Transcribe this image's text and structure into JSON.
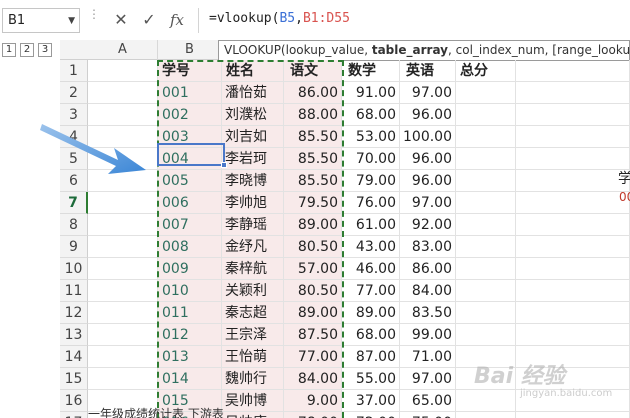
{
  "name_box": {
    "value": "B1"
  },
  "formula_bar": {
    "prefix": "=vlookup(",
    "ref1": "B5",
    "sep": ",",
    "ref2": "B1:D55",
    "fx_label": "fx"
  },
  "tooltip": {
    "func": "VLOOKUP(",
    "arg1": "lookup_value, ",
    "arg2": "table_array",
    "rest": ", col_index_num, [range_lookup])"
  },
  "outline_levels": [
    "1",
    "2",
    "3"
  ],
  "columns": {
    "a": "A",
    "b": "B"
  },
  "rows": [
    {
      "num": "1",
      "b": "学号",
      "c": "姓名",
      "d": "语文",
      "e": "数学",
      "f": "英语",
      "g": "总分",
      "header": true
    },
    {
      "num": "2",
      "b": "001",
      "c": "潘怡茹",
      "d": "86.00",
      "e": "91.00",
      "f": "97.00"
    },
    {
      "num": "3",
      "b": "002",
      "c": "刘濮松",
      "d": "88.00",
      "e": "68.00",
      "f": "96.00"
    },
    {
      "num": "4",
      "b": "003",
      "c": "刘吉如",
      "d": "85.50",
      "e": "53.00",
      "f": "100.00"
    },
    {
      "num": "5",
      "b": "004",
      "c": "李岩珂",
      "d": "85.50",
      "e": "70.00",
      "f": "96.00"
    },
    {
      "num": "6",
      "b": "005",
      "c": "李晓博",
      "d": "85.50",
      "e": "79.00",
      "f": "96.00"
    },
    {
      "num": "7",
      "b": "006",
      "c": "李帅旭",
      "d": "79.50",
      "e": "76.00",
      "f": "97.00",
      "selected": true
    },
    {
      "num": "8",
      "b": "007",
      "c": "李静瑶",
      "d": "89.00",
      "e": "61.00",
      "f": "92.00"
    },
    {
      "num": "9",
      "b": "008",
      "c": "金纾凡",
      "d": "80.50",
      "e": "43.00",
      "f": "83.00"
    },
    {
      "num": "10",
      "b": "009",
      "c": "秦梓航",
      "d": "57.00",
      "e": "46.00",
      "f": "86.00"
    },
    {
      "num": "11",
      "b": "010",
      "c": "关颖利",
      "d": "80.50",
      "e": "77.00",
      "f": "84.00"
    },
    {
      "num": "12",
      "b": "011",
      "c": "秦志超",
      "d": "89.00",
      "e": "89.00",
      "f": "83.50"
    },
    {
      "num": "13",
      "b": "012",
      "c": "王宗泽",
      "d": "87.50",
      "e": "68.00",
      "f": "99.00"
    },
    {
      "num": "14",
      "b": "013",
      "c": "王怡萌",
      "d": "77.00",
      "e": "87.00",
      "f": "71.00"
    },
    {
      "num": "15",
      "b": "014",
      "c": "魏帅行",
      "d": "84.00",
      "e": "55.00",
      "f": "97.00"
    },
    {
      "num": "16",
      "b": "015",
      "c": "吴帅博",
      "d": "9.00",
      "e": "37.00",
      "f": "65.00"
    },
    {
      "num": "17",
      "b": "016",
      "c": "吴帅康",
      "d": "78.00",
      "e": "72.00",
      "f": "75.00"
    }
  ],
  "side": {
    "label1": "学",
    "label2": "00"
  },
  "sheet_tabs": "一年级成绩统计表  下游表",
  "watermark": {
    "main": "Bai 经验",
    "sub": "jingyan.baidu.com"
  },
  "colors": {
    "accent_green": "#2e7d32",
    "selection_blue": "#4a78c9",
    "ref_red": "#d9534f",
    "ref_blue": "#3a6fd6"
  }
}
